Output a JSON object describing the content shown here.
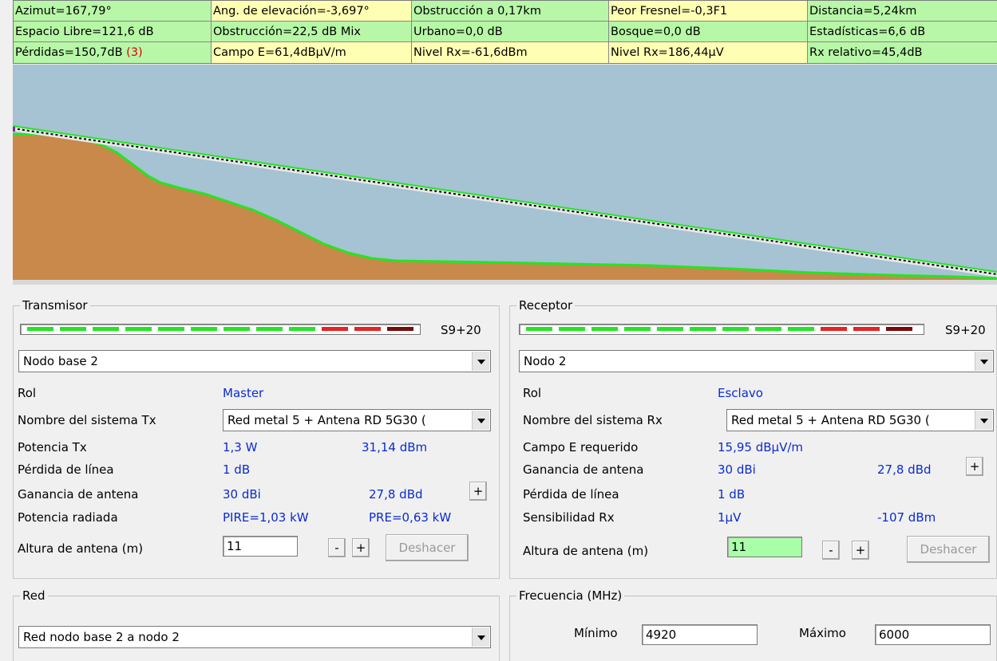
{
  "info": {
    "row1": [
      "Azimut=167,79°",
      "Ang. de elevación=-3,697°",
      "Obstrucción a 0,17km",
      "Peor Fresnel=-0,3F1",
      "Distancia=5,24km"
    ],
    "row2": [
      "Espacio Libre=121,6 dB",
      "Obstrucción=22,5 dB Mix",
      "Urbano=0,0 dB",
      "Bosque=0,0 dB",
      "Estadísticas=6,6 dB"
    ],
    "row3_loss": "Pérdidas=150,7dB",
    "row3_loss_flag": "(3)",
    "row3": [
      "Campo E=61,4dBµV/m",
      "Nivel Rx=-61,6dBm",
      "Nivel Rx=186,44µV",
      "Rx relativo=45,4dB"
    ]
  },
  "profile": {
    "sky_color": "#a5c3d2",
    "terrain_color": "#c8894a",
    "terrain_edge_color": "#22e622"
  },
  "transmitter": {
    "title": "Transmisor",
    "signal_label": "S9+20",
    "node": "Nodo base 2",
    "role_label": "Rol",
    "role_value": "Master",
    "system_label": "Nombre del sistema Tx",
    "system_value": "Red metal 5 + Antena RD 5G30 (",
    "power_label": "Potencia Tx",
    "power_w": "1,3 W",
    "power_dbm": "31,14 dBm",
    "line_loss_label": "Pérdida de línea",
    "line_loss_value": "1 dB",
    "gain_label": "Ganancia de antena",
    "gain_dbi": "30 dBi",
    "gain_dbd": "27,8 dBd",
    "plus": "+",
    "radiated_label": "Potencia radiada",
    "pire": "PIRE=1,03 kW",
    "pre": "PRE=0,63 kW",
    "height_label": "Altura de antena (m)",
    "height_value": "11",
    "minus": "-",
    "undo": "Deshacer"
  },
  "receiver": {
    "title": "Receptor",
    "signal_label": "S9+20",
    "node": "Nodo 2",
    "role_label": "Rol",
    "role_value": "Esclavo",
    "system_label": "Nombre del sistema Rx",
    "system_value": "Red metal 5 + Antena RD 5G30 (",
    "field_label": "Campo E requerido",
    "field_value": "15,95 dBµV/m",
    "gain_label": "Ganancia de antena",
    "gain_dbi": "30 dBi",
    "gain_dbd": "27,8 dBd",
    "plus": "+",
    "line_loss_label": "Pérdida de línea",
    "line_loss_value": "1 dB",
    "sens_label": "Sensibilidad Rx",
    "sens_uv": "1µV",
    "sens_dbm": "-107 dBm",
    "height_label": "Altura de antena (m)",
    "height_value": "11",
    "minus": "-",
    "undo": "Deshacer"
  },
  "network": {
    "title": "Red",
    "value": "Red nodo base 2 a nodo 2"
  },
  "frequency": {
    "title": "Frecuencia (MHz)",
    "min_label": "Mínimo",
    "min_value": "4920",
    "max_label": "Máximo",
    "max_value": "6000"
  },
  "meter": {
    "green": "#22e622",
    "red": "#e62222",
    "dark_red": "#7a0a0a",
    "segments": [
      "green",
      "green",
      "green",
      "green",
      "green",
      "green",
      "green",
      "green",
      "green",
      "red",
      "red",
      "dark_red"
    ]
  }
}
